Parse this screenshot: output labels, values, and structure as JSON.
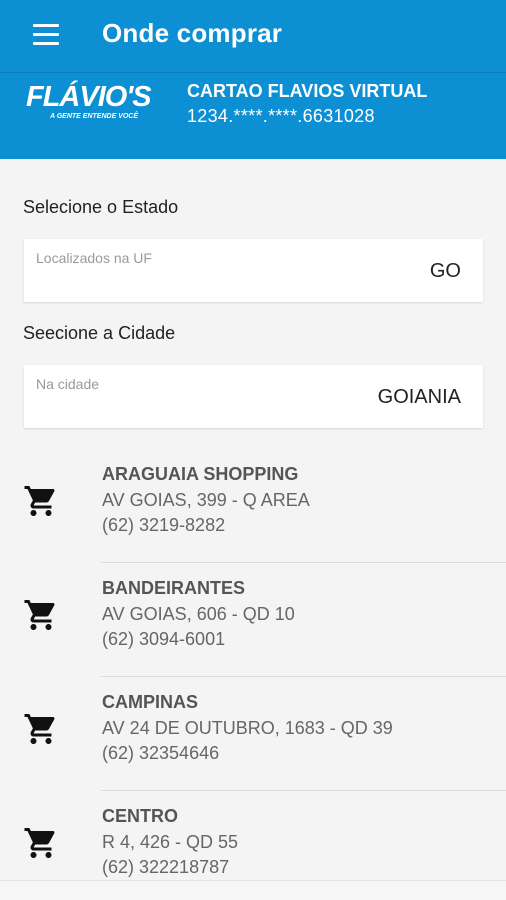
{
  "appbar": {
    "title": "Onde comprar",
    "menu_icon": "hamburger-menu-icon"
  },
  "card": {
    "logo_text": "FLÁVIO'S",
    "logo_tagline": "A GENTE ENTENDE VOCÊ",
    "title": "CARTAO FLAVIOS VIRTUAL",
    "number": "1234.****.****.6631028"
  },
  "state": {
    "label": "Selecione o Estado",
    "hint": "Localizados na UF",
    "value": "GO"
  },
  "city": {
    "label": "Seecione a Cidade",
    "hint": "Na cidade",
    "value": "GOIANIA"
  },
  "stores": [
    {
      "name": "ARAGUAIA SHOPPING",
      "address": "AV GOIAS, 399 - Q AREA",
      "phone": "(62) 3219-8282"
    },
    {
      "name": "BANDEIRANTES",
      "address": "AV GOIAS, 606 - QD 10",
      "phone": "(62) 3094-6001"
    },
    {
      "name": "CAMPINAS",
      "address": "AV 24 DE OUTUBRO, 1683 - QD 39",
      "phone": "(62) 32354646"
    },
    {
      "name": "CENTRO",
      "address": "R 4, 426 - QD 55",
      "phone": "(62) 322218787"
    }
  ],
  "colors": {
    "primary": "#0d8fd3",
    "background": "#f4f4f4",
    "icon": "#111111"
  }
}
